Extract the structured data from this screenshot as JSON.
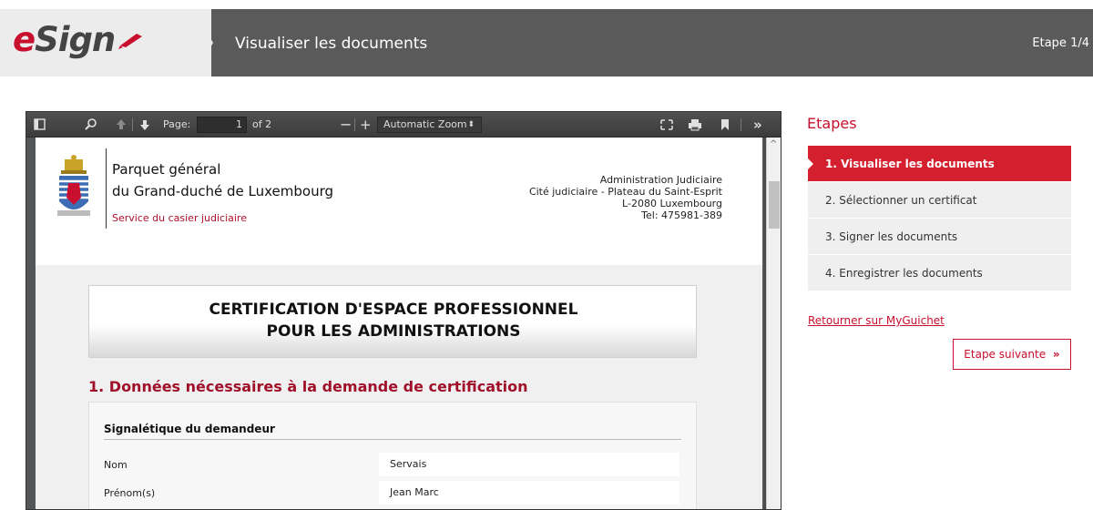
{
  "header": {
    "logo_text_e": "e",
    "logo_text_rest": "Sign",
    "title": "Visualiser les documents",
    "step_indicator": "Etape 1/4"
  },
  "viewer": {
    "page_label": "Page:",
    "page_current": "1",
    "page_total": "of 2",
    "zoom": "Automatic Zoom",
    "zoom_arrow": "⌃⌄",
    "pdf": {
      "org_line1": "Parquet général",
      "org_line2": "du Grand-duché de Luxembourg",
      "org_line3": "Service du casier judiciaire",
      "address": [
        "Administration Judiciaire",
        "Cité judiciaire - Plateau du Saint-Esprit",
        "L-2080 Luxembourg",
        "Tel: 475981-389"
      ],
      "cert_title_1": "CERTIFICATION D'ESPACE PROFESSIONNEL",
      "cert_title_2": "POUR LES ADMINISTRATIONS",
      "section_title": "1. Données nécessaires à la demande de certification",
      "data_heading": "Signalétique du demandeur",
      "rows": [
        {
          "label": "Nom",
          "value": "Servais"
        },
        {
          "label": "Prénom(s)",
          "value": "Jean Marc"
        }
      ]
    }
  },
  "sidebar": {
    "title": "Etapes",
    "steps": [
      {
        "label": "1. Visualiser les documents",
        "active": true
      },
      {
        "label": "2. Sélectionner un certificat",
        "active": false
      },
      {
        "label": "3. Signer les documents",
        "active": false
      },
      {
        "label": "4. Enregistrer les documents",
        "active": false
      }
    ],
    "back_link": "Retourner sur MyGuichet",
    "next_button": "Etape suivante",
    "next_icon": "»"
  },
  "colors": {
    "accent": "#c8102e",
    "header_bg": "#5a5a5a",
    "active_step": "#d31f2e"
  }
}
